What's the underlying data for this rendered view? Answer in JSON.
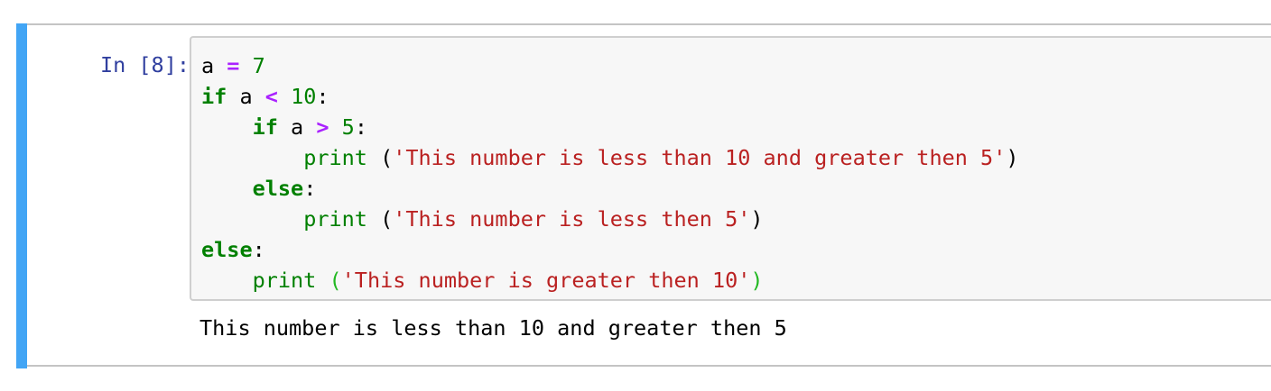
{
  "cell": {
    "prompt": "In [8]:",
    "code_lines": [
      [
        {
          "t": "a ",
          "c": "plain"
        },
        {
          "t": "=",
          "c": "op"
        },
        {
          "t": " ",
          "c": "plain"
        },
        {
          "t": "7",
          "c": "num"
        }
      ],
      [
        {
          "t": "if",
          "c": "kw"
        },
        {
          "t": " a ",
          "c": "plain"
        },
        {
          "t": "<",
          "c": "op"
        },
        {
          "t": " ",
          "c": "plain"
        },
        {
          "t": "10",
          "c": "num"
        },
        {
          "t": ":",
          "c": "plain"
        }
      ],
      [
        {
          "t": "    ",
          "c": "plain"
        },
        {
          "t": "if",
          "c": "kw"
        },
        {
          "t": " a ",
          "c": "plain"
        },
        {
          "t": ">",
          "c": "op"
        },
        {
          "t": " ",
          "c": "plain"
        },
        {
          "t": "5",
          "c": "num"
        },
        {
          "t": ":",
          "c": "plain"
        }
      ],
      [
        {
          "t": "        ",
          "c": "plain"
        },
        {
          "t": "print",
          "c": "bi"
        },
        {
          "t": " (",
          "c": "plain"
        },
        {
          "t": "'This number is less than 10 and greater then 5'",
          "c": "str"
        },
        {
          "t": ")",
          "c": "plain"
        }
      ],
      [
        {
          "t": "    ",
          "c": "plain"
        },
        {
          "t": "else",
          "c": "kw"
        },
        {
          "t": ":",
          "c": "plain"
        }
      ],
      [
        {
          "t": "        ",
          "c": "plain"
        },
        {
          "t": "print",
          "c": "bi"
        },
        {
          "t": " (",
          "c": "plain"
        },
        {
          "t": "'This number is less then 5'",
          "c": "str"
        },
        {
          "t": ")",
          "c": "plain"
        }
      ],
      [
        {
          "t": "else",
          "c": "kw"
        },
        {
          "t": ":",
          "c": "plain"
        }
      ],
      [
        {
          "t": "    ",
          "c": "plain"
        },
        {
          "t": "print",
          "c": "bi"
        },
        {
          "t": " ",
          "c": "plain"
        },
        {
          "t": "(",
          "c": "p-hl"
        },
        {
          "t": "'This number is greater then 10'",
          "c": "str"
        },
        {
          "t": ")",
          "c": "p-hl"
        }
      ]
    ],
    "output": "This number is less than 10 and greater then 5"
  },
  "colors": {
    "accent": "#42a5f5",
    "prompt": "#303f9f",
    "keyword": "#008000",
    "operator": "#aa22ff",
    "string": "#ba2121",
    "matched_bracket": "#22b822"
  }
}
